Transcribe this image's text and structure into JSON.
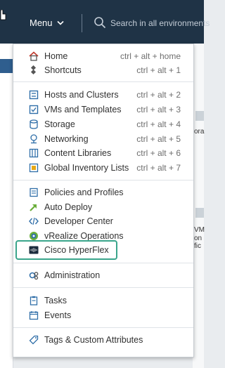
{
  "topbar": {
    "menu_label": "Menu",
    "search_placeholder": "Search in all environments"
  },
  "background": {
    "right_texts": [
      "ora",
      "VM",
      "on",
      "fic"
    ]
  },
  "menu": {
    "home": {
      "label": "Home",
      "shortcut": "ctrl + alt + home",
      "icon": "home-icon"
    },
    "shortcuts": {
      "label": "Shortcuts",
      "shortcut": "ctrl + alt + 1",
      "icon": "shortcuts-icon"
    },
    "hosts": {
      "label": "Hosts and Clusters",
      "shortcut": "ctrl + alt + 2",
      "icon": "hosts-clusters-icon"
    },
    "vms": {
      "label": "VMs and Templates",
      "shortcut": "ctrl + alt + 3",
      "icon": "vms-templates-icon"
    },
    "storage": {
      "label": "Storage",
      "shortcut": "ctrl + alt + 4",
      "icon": "storage-icon"
    },
    "networking": {
      "label": "Networking",
      "shortcut": "ctrl + alt + 5",
      "icon": "networking-icon"
    },
    "content_libraries": {
      "label": "Content Libraries",
      "shortcut": "ctrl + alt + 6",
      "icon": "content-libraries-icon"
    },
    "global_inventory": {
      "label": "Global Inventory Lists",
      "shortcut": "ctrl + alt + 7",
      "icon": "global-inventory-icon"
    },
    "policies": {
      "label": "Policies and Profiles",
      "icon": "policies-icon"
    },
    "auto_deploy": {
      "label": "Auto Deploy",
      "icon": "auto-deploy-icon"
    },
    "developer_center": {
      "label": "Developer Center",
      "icon": "developer-center-icon"
    },
    "vrealize": {
      "label": "vRealize Operations",
      "icon": "vrealize-icon"
    },
    "cisco_hyperflex": {
      "label": "Cisco HyperFlex",
      "icon": "cisco-hyperflex-icon"
    },
    "administration": {
      "label": "Administration",
      "icon": "administration-icon"
    },
    "tasks": {
      "label": "Tasks",
      "icon": "tasks-icon"
    },
    "events": {
      "label": "Events",
      "icon": "events-icon"
    },
    "tags": {
      "label": "Tags & Custom Attributes",
      "icon": "tags-icon"
    }
  },
  "colors": {
    "topbar": "#1f3346",
    "highlight_border": "#3aa58b",
    "icon_blue": "#2f6ea8",
    "icon_green": "#6aae3a"
  }
}
